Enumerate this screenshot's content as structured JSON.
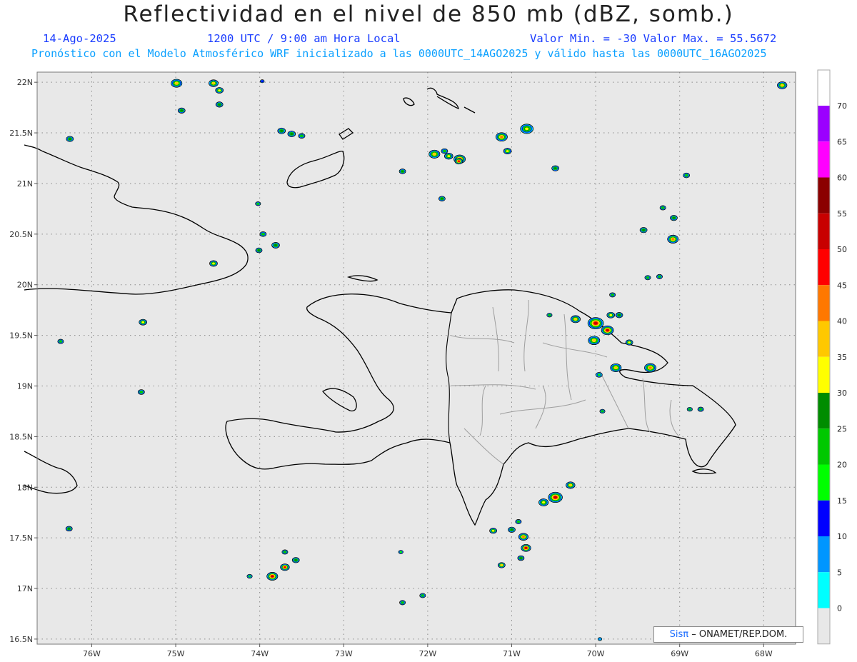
{
  "header": {
    "title": "Reflectividad en el nivel de 850 mb (dBZ, somb.)",
    "date": "14-Ago-2025",
    "time": "1200 UTC / 9:00 am Hora Local",
    "minmax": "Valor Min. = -30  Valor Max. = 55.5672",
    "forecast": "Pronóstico con el Modelo Atmosférico WRF inicializado a las 0000UTC_14AGO2025 y válido hasta las  0000UTC_16AGO2025"
  },
  "map": {
    "lat_labels": [
      "22N",
      "21.5N",
      "21N",
      "20.5N",
      "20N",
      "19.5N",
      "19N",
      "18.5N",
      "18N",
      "17.5N",
      "17N",
      "16.5N"
    ],
    "lon_labels": [
      "76W",
      "75W",
      "74W",
      "73W",
      "72W",
      "71W",
      "70W",
      "69W",
      "68W"
    ],
    "extent": {
      "lon_min": -76.65,
      "lon_max": -67.62,
      "lat_min": 16.45,
      "lat_max": 22.1
    },
    "background": "#e8e8e8"
  },
  "colorbar": {
    "labels": [
      "70",
      "65",
      "60",
      "55",
      "50",
      "45",
      "40",
      "35",
      "30",
      "25",
      "20",
      "15",
      "10",
      "5",
      "0"
    ],
    "colors": [
      "#ffffff",
      "#9b00ff",
      "#ff00ff",
      "#8b0000",
      "#c80000",
      "#ff0000",
      "#ff7800",
      "#ffc800",
      "#ffff00",
      "#008c00",
      "#00c800",
      "#00ff00",
      "#0000ff",
      "#0096ff",
      "#00ffff",
      "#e8e8e8"
    ]
  },
  "credit": {
    "sis": "Sisπ",
    "org": "– ONAMET/REP.DOM."
  },
  "cells": [
    {
      "lon": -74.99,
      "lat": 21.99,
      "size": 3,
      "intensity": 38
    },
    {
      "lon": -74.55,
      "lat": 21.99,
      "size": 2.5,
      "intensity": 35
    },
    {
      "lon": -74.48,
      "lat": 21.92,
      "size": 2,
      "intensity": 30
    },
    {
      "lon": -74.48,
      "lat": 21.78,
      "size": 1.8,
      "intensity": 25
    },
    {
      "lon": -74.93,
      "lat": 21.72,
      "size": 1.8,
      "intensity": 28
    },
    {
      "lon": -76.26,
      "lat": 21.44,
      "size": 1.8,
      "intensity": 28
    },
    {
      "lon": -73.74,
      "lat": 21.52,
      "size": 2,
      "intensity": 28
    },
    {
      "lon": -73.62,
      "lat": 21.49,
      "size": 2,
      "intensity": 25
    },
    {
      "lon": -73.5,
      "lat": 21.47,
      "size": 1.6,
      "intensity": 22
    },
    {
      "lon": -71.92,
      "lat": 21.29,
      "size": 3,
      "intensity": 38
    },
    {
      "lon": -71.75,
      "lat": 21.27,
      "size": 2.2,
      "intensity": 30
    },
    {
      "lon": -71.62,
      "lat": 21.24,
      "size": 3.2,
      "intensity": 50
    },
    {
      "lon": -71.8,
      "lat": 21.32,
      "size": 1.6,
      "intensity": 22
    },
    {
      "lon": -72.3,
      "lat": 21.12,
      "size": 1.6,
      "intensity": 25
    },
    {
      "lon": -71.63,
      "lat": 21.22,
      "size": 2,
      "intensity": 45
    },
    {
      "lon": -71.12,
      "lat": 21.46,
      "size": 3.2,
      "intensity": 40
    },
    {
      "lon": -71.05,
      "lat": 21.32,
      "size": 2,
      "intensity": 30
    },
    {
      "lon": -70.82,
      "lat": 21.54,
      "size": 3.6,
      "intensity": 32
    },
    {
      "lon": -70.48,
      "lat": 21.15,
      "size": 1.8,
      "intensity": 25
    },
    {
      "lon": -71.83,
      "lat": 20.85,
      "size": 1.6,
      "intensity": 25
    },
    {
      "lon": -74.02,
      "lat": 20.8,
      "size": 1.2,
      "intensity": 20
    },
    {
      "lon": -73.96,
      "lat": 20.5,
      "size": 1.6,
      "intensity": 22
    },
    {
      "lon": -73.81,
      "lat": 20.39,
      "size": 2,
      "intensity": 25
    },
    {
      "lon": -74.01,
      "lat": 20.34,
      "size": 1.6,
      "intensity": 28
    },
    {
      "lon": -74.55,
      "lat": 20.21,
      "size": 2,
      "intensity": 30
    },
    {
      "lon": -75.39,
      "lat": 19.63,
      "size": 2,
      "intensity": 32
    },
    {
      "lon": -76.37,
      "lat": 19.44,
      "size": 1.4,
      "intensity": 20
    },
    {
      "lon": -75.41,
      "lat": 18.94,
      "size": 1.6,
      "intensity": 22
    },
    {
      "lon": -69.43,
      "lat": 20.54,
      "size": 1.8,
      "intensity": 28
    },
    {
      "lon": -69.08,
      "lat": 20.45,
      "size": 3,
      "intensity": 40
    },
    {
      "lon": -69.07,
      "lat": 20.66,
      "size": 1.8,
      "intensity": 28
    },
    {
      "lon": -68.92,
      "lat": 21.08,
      "size": 1.6,
      "intensity": 22
    },
    {
      "lon": -69.2,
      "lat": 20.76,
      "size": 1.4,
      "intensity": 20
    },
    {
      "lon": -69.38,
      "lat": 20.07,
      "size": 1.4,
      "intensity": 20
    },
    {
      "lon": -69.24,
      "lat": 20.08,
      "size": 1.4,
      "intensity": 20
    },
    {
      "lon": -69.8,
      "lat": 19.9,
      "size": 1.4,
      "intensity": 22
    },
    {
      "lon": -67.78,
      "lat": 21.97,
      "size": 2.6,
      "intensity": 38
    },
    {
      "lon": -70.24,
      "lat": 19.66,
      "size": 2.6,
      "intensity": 38
    },
    {
      "lon": -70.0,
      "lat": 19.62,
      "size": 4.5,
      "intensity": 55
    },
    {
      "lon": -69.86,
      "lat": 19.55,
      "size": 3.4,
      "intensity": 50
    },
    {
      "lon": -70.02,
      "lat": 19.45,
      "size": 3.2,
      "intensity": 35
    },
    {
      "lon": -69.82,
      "lat": 19.7,
      "size": 2,
      "intensity": 30
    },
    {
      "lon": -69.72,
      "lat": 19.7,
      "size": 1.8,
      "intensity": 28
    },
    {
      "lon": -69.6,
      "lat": 19.43,
      "size": 1.8,
      "intensity": 30
    },
    {
      "lon": -70.55,
      "lat": 19.7,
      "size": 1.2,
      "intensity": 20
    },
    {
      "lon": -69.76,
      "lat": 19.18,
      "size": 3,
      "intensity": 38
    },
    {
      "lon": -69.35,
      "lat": 19.18,
      "size": 3.2,
      "intensity": 42
    },
    {
      "lon": -69.96,
      "lat": 19.11,
      "size": 1.6,
      "intensity": 15
    },
    {
      "lon": -69.92,
      "lat": 18.75,
      "size": 1.2,
      "intensity": 20
    },
    {
      "lon": -68.75,
      "lat": 18.77,
      "size": 1.4,
      "intensity": 22
    },
    {
      "lon": -68.88,
      "lat": 18.77,
      "size": 1.2,
      "intensity": 20
    },
    {
      "lon": -70.48,
      "lat": 17.9,
      "size": 4,
      "intensity": 50
    },
    {
      "lon": -70.3,
      "lat": 18.02,
      "size": 2.4,
      "intensity": 35
    },
    {
      "lon": -70.62,
      "lat": 17.85,
      "size": 2.6,
      "intensity": 32
    },
    {
      "lon": -71.22,
      "lat": 17.57,
      "size": 1.8,
      "intensity": 30
    },
    {
      "lon": -71.0,
      "lat": 17.58,
      "size": 1.8,
      "intensity": 28
    },
    {
      "lon": -70.86,
      "lat": 17.51,
      "size": 2.6,
      "intensity": 40
    },
    {
      "lon": -70.83,
      "lat": 17.4,
      "size": 2.6,
      "intensity": 50
    },
    {
      "lon": -70.89,
      "lat": 17.3,
      "size": 1.6,
      "intensity": 25
    },
    {
      "lon": -70.92,
      "lat": 17.66,
      "size": 1.4,
      "intensity": 22
    },
    {
      "lon": -71.12,
      "lat": 17.23,
      "size": 1.8,
      "intensity": 35
    },
    {
      "lon": -73.85,
      "lat": 17.12,
      "size": 3,
      "intensity": 50
    },
    {
      "lon": -73.7,
      "lat": 17.21,
      "size": 2.4,
      "intensity": 45
    },
    {
      "lon": -73.57,
      "lat": 17.28,
      "size": 1.8,
      "intensity": 28
    },
    {
      "lon": -73.7,
      "lat": 17.36,
      "size": 1.4,
      "intensity": 22
    },
    {
      "lon": -74.12,
      "lat": 17.12,
      "size": 1.2,
      "intensity": 15
    },
    {
      "lon": -72.32,
      "lat": 17.36,
      "size": 1,
      "intensity": 15
    },
    {
      "lon": -72.3,
      "lat": 16.86,
      "size": 1.4,
      "intensity": 22
    },
    {
      "lon": -72.06,
      "lat": 16.93,
      "size": 1.4,
      "intensity": 22
    },
    {
      "lon": -76.27,
      "lat": 17.59,
      "size": 1.6,
      "intensity": 25
    },
    {
      "lon": -69.95,
      "lat": 16.5,
      "size": 0.8,
      "intensity": 5
    },
    {
      "lon": -73.97,
      "lat": 22.01,
      "size": 0.8,
      "intensity": 10
    }
  ]
}
